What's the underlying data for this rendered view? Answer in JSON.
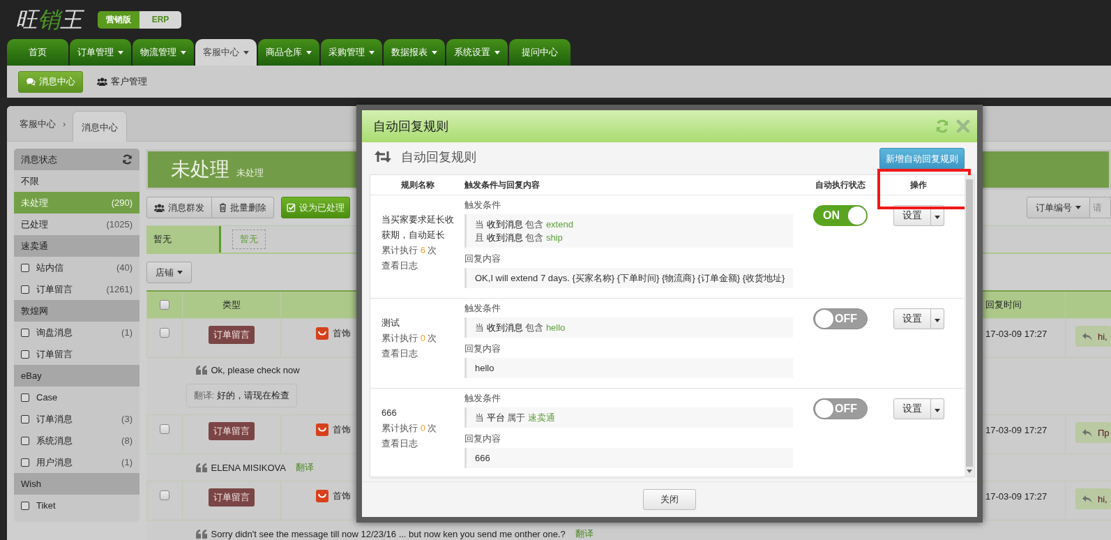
{
  "header": {
    "logo": "旺销王",
    "editions": [
      {
        "label": "营销版",
        "selected": true
      },
      {
        "label": "ERP",
        "selected": false
      }
    ]
  },
  "nav_tabs": [
    {
      "label": "首页",
      "has_menu": false,
      "selected": false
    },
    {
      "label": "订单管理",
      "has_menu": true,
      "selected": false
    },
    {
      "label": "物流管理",
      "has_menu": true,
      "selected": false
    },
    {
      "label": "客服中心",
      "has_menu": true,
      "selected": true
    },
    {
      "label": "商品仓库",
      "has_menu": true,
      "selected": false
    },
    {
      "label": "采购管理",
      "has_menu": true,
      "selected": false
    },
    {
      "label": "数据报表",
      "has_menu": true,
      "selected": false
    },
    {
      "label": "系统设置",
      "has_menu": true,
      "selected": false
    },
    {
      "label": "提问中心",
      "has_menu": false,
      "selected": false
    }
  ],
  "sub_nav": [
    {
      "label": "消息中心",
      "selected": true
    },
    {
      "label": "客户管理",
      "selected": false
    }
  ],
  "breadcrumb": {
    "parent": "客服中心",
    "separator": "›",
    "tab": "消息中心"
  },
  "sidebar": {
    "groups": [
      {
        "title": "消息状态",
        "refresh": true,
        "items": [
          {
            "kind": "status",
            "label": "不限",
            "selected": false
          },
          {
            "kind": "status",
            "label": "未处理",
            "count": "(290)",
            "selected": true
          },
          {
            "kind": "status",
            "label": "已处理",
            "count": "(1025)",
            "selected": false
          }
        ]
      },
      {
        "title": "速卖通",
        "refresh": false,
        "items": [
          {
            "kind": "checkbox",
            "label": "站内信",
            "count": "(40)",
            "checked": false
          },
          {
            "kind": "checkbox",
            "label": "订单留言",
            "count": "(1261)",
            "checked": false
          }
        ]
      },
      {
        "title": "敦煌网",
        "refresh": false,
        "items": [
          {
            "kind": "checkbox",
            "label": "询盘消息",
            "count": "(1)",
            "checked": false
          },
          {
            "kind": "checkbox",
            "label": "订单留言",
            "checked": false
          }
        ]
      },
      {
        "title": "eBay",
        "refresh": false,
        "items": [
          {
            "kind": "checkbox",
            "label": "Case",
            "checked": false
          },
          {
            "kind": "checkbox",
            "label": "订单消息",
            "count": "(3)",
            "checked": false
          },
          {
            "kind": "checkbox",
            "label": "系统消息",
            "count": "(8)",
            "checked": false
          },
          {
            "kind": "checkbox",
            "label": "用户消息",
            "count": "(1)",
            "checked": false
          }
        ]
      },
      {
        "title": "Wish",
        "refresh": false,
        "items": [
          {
            "kind": "checkbox",
            "label": "Tiket",
            "checked": false
          }
        ]
      }
    ]
  },
  "banner": {
    "title": "未处理",
    "subtitle": "未处理"
  },
  "toolbar": {
    "buttons": [
      {
        "label": "消息群发",
        "kind": "default"
      },
      {
        "label": "批量删除",
        "kind": "default"
      },
      {
        "label": "设为已处理",
        "kind": "primary"
      }
    ],
    "search_field": "订单编号",
    "search_placeholder": "请"
  },
  "filter": {
    "label": "暂无",
    "tag": "暂无"
  },
  "store_filter": "店铺",
  "messages": {
    "select_all_checked": false,
    "columns": {
      "type": "类型",
      "time": "回复时间"
    },
    "rows": [
      {
        "checked": false,
        "type": "订单留言",
        "store": "首饰",
        "time": "17-03-09 17:27",
        "reply": "hi,",
        "message": "Ok, please check now",
        "translation_label": "翻译:",
        "translation": "好的，请现在检查"
      },
      {
        "checked": false,
        "type": "订单留言",
        "store": "首饰",
        "time": "17-03-09 17:27",
        "reply": "Пр",
        "message": "ELENA MISIKOVA",
        "translate_link": "翻译"
      },
      {
        "checked": false,
        "type": "订单留言",
        "store": "首饰",
        "time": "17-03-09 17:27",
        "reply": "hi,",
        "message": "Sorry didn't see the message till now 12/23/16 ... but now ken you send me onther one.?",
        "translate_link": "翻译"
      }
    ]
  },
  "dialog": {
    "title": "自动回复规则",
    "heading": "自动回复规则",
    "add_button": "新增自动回复规则",
    "columns": [
      "规则名称",
      "触发条件与回复内容",
      "自动执行状态",
      "操作"
    ],
    "rules": [
      {
        "name": "当买家要求延长收获期，自动延长",
        "run_label": "累计执行",
        "run_count": "6",
        "run_unit": "次",
        "log_link": "查看日志",
        "trigger_label": "触发条件",
        "conditions": [
          {
            "prefix": "当",
            "field": "收到消息",
            "op": "包含",
            "value": "extend"
          },
          {
            "prefix": "且",
            "field": "收到消息",
            "op": "包含",
            "value": "ship"
          }
        ],
        "reply_label": "回复内容",
        "reply": "OK,I will extend 7 days. {买家名称} {下单时间} {物流商} {订单金额} {收货地址}",
        "on": true,
        "switch_label": "ON",
        "settings_button": "设置"
      },
      {
        "name": "测试",
        "run_label": "累计执行",
        "run_count": "0",
        "run_unit": "次",
        "log_link": "查看日志",
        "trigger_label": "触发条件",
        "conditions": [
          {
            "prefix": "当",
            "field": "收到消息",
            "op": "包含",
            "value": "hello"
          }
        ],
        "reply_label": "回复内容",
        "reply": "hello",
        "on": false,
        "switch_label": "OFF",
        "settings_button": "设置"
      },
      {
        "name": "666",
        "run_label": "累计执行",
        "run_count": "0",
        "run_unit": "次",
        "log_link": "查看日志",
        "trigger_label": "触发条件",
        "conditions": [
          {
            "prefix": "当",
            "field": "平台",
            "op": "属于",
            "value": "速卖通"
          }
        ],
        "reply_label": "回复内容",
        "reply": "666",
        "on": false,
        "switch_label": "OFF",
        "settings_button": "设置"
      }
    ],
    "close_button": "关闭"
  }
}
